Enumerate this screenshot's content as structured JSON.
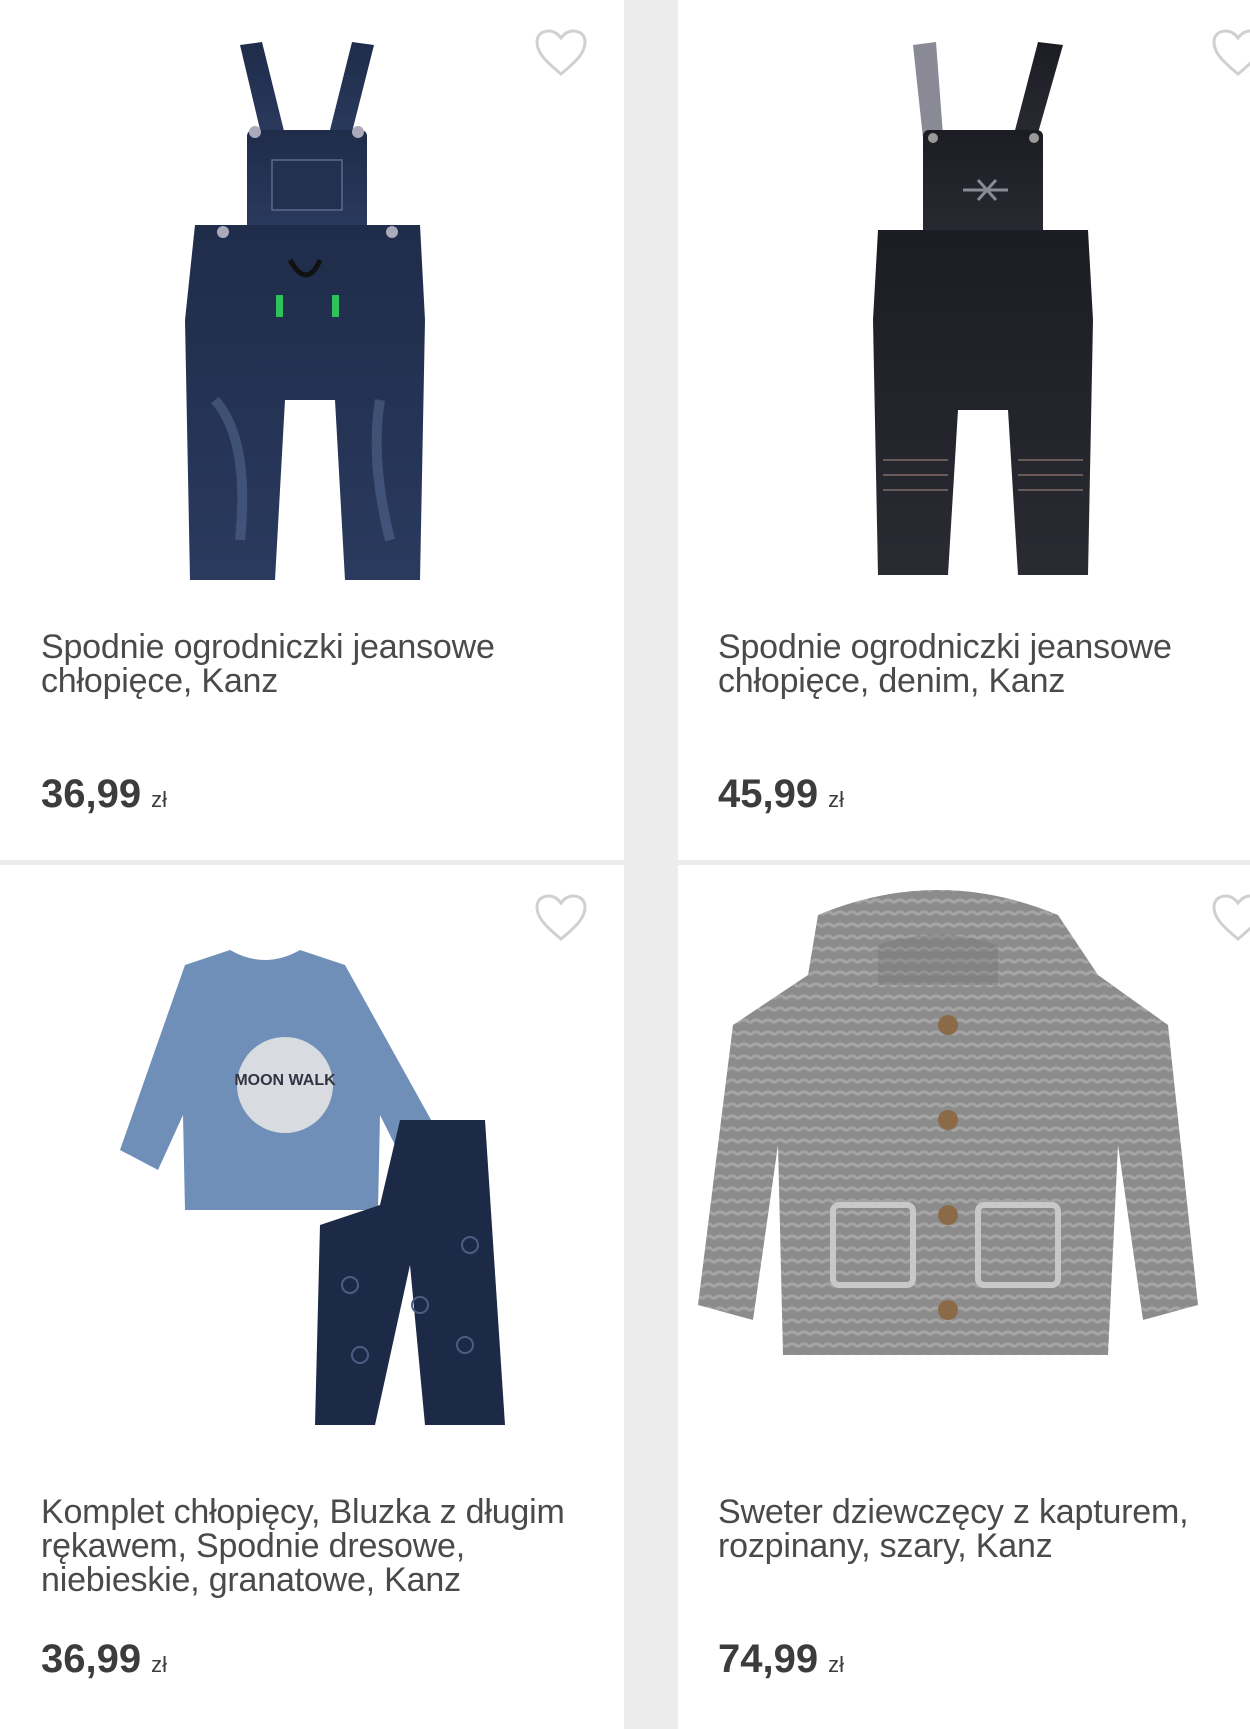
{
  "products": [
    {
      "title": "Spodnie ogrodniczki jeansowe chłopięce, Kanz",
      "price": "36,99",
      "currency": "zł",
      "image_icon": "denim-overalls-image"
    },
    {
      "title": "Spodnie ogrodniczki jeansowe chłopięce, denim, Kanz",
      "price": "45,99",
      "currency": "zł",
      "image_icon": "dark-denim-overalls-image"
    },
    {
      "title": "Komplet chłopięcy, Bluzka z długim rękawem, Spodnie dresowe, niebieskie, granatowe, Kanz",
      "price": "36,99",
      "currency": "zł",
      "image_icon": "shirt-and-pants-set-image",
      "print_text": "MOON WALK"
    },
    {
      "title": "Sweter dziewczęcy z kapturem, rozpinany, szary, Kanz",
      "price": "74,99",
      "currency": "zł",
      "image_icon": "grey-knit-hoodie-image"
    }
  ],
  "colors": {
    "heart_outline": "#d0d0d0",
    "background": "#ececec",
    "card": "#ffffff"
  }
}
